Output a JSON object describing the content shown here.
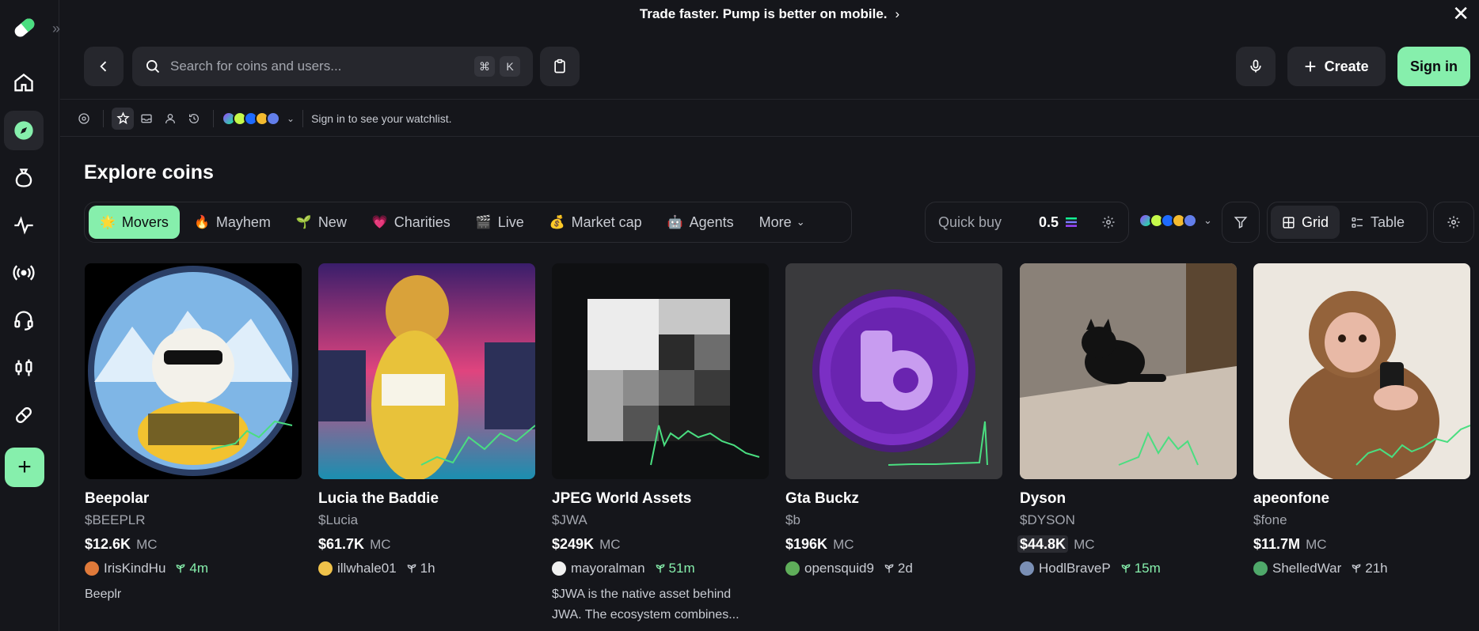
{
  "banner": {
    "text": "Trade faster. Pump is better on mobile."
  },
  "header": {
    "search_placeholder": "Search for coins and users...",
    "shortcut_cmd": "⌘",
    "shortcut_key": "K",
    "create_label": "Create",
    "signin_label": "Sign in"
  },
  "watchbar": {
    "message": "Sign in to see your watchlist."
  },
  "explore": {
    "title": "Explore coins",
    "tabs": [
      {
        "emoji": "🌟",
        "label": "Movers"
      },
      {
        "emoji": "🔥",
        "label": "Mayhem"
      },
      {
        "emoji": "🌱",
        "label": "New"
      },
      {
        "emoji": "💗",
        "label": "Charities"
      },
      {
        "emoji": "🎬",
        "label": "Live"
      },
      {
        "emoji": "💰",
        "label": "Market cap"
      },
      {
        "emoji": "🤖",
        "label": "Agents"
      },
      {
        "emoji": "",
        "label": "More"
      }
    ],
    "quick_buy_label": "Quick buy",
    "quick_buy_value": "0.5",
    "view_grid": "Grid",
    "view_table": "Table"
  },
  "colors": {
    "accent": "#86efac",
    "background": "#15161b",
    "surface": "#26272d"
  },
  "coins": [
    {
      "name": "Beepolar",
      "ticker": "$BEEPLR",
      "mc": "$12.6K",
      "mc_suffix": "MC",
      "creator": "IrisKindHu",
      "age": "4m",
      "age_green": true,
      "description": "Beeplr"
    },
    {
      "name": "Lucia the Baddie",
      "ticker": "$Lucia",
      "mc": "$61.7K",
      "mc_suffix": "MC",
      "creator": "illwhale01",
      "age": "1h",
      "age_green": false,
      "description": ""
    },
    {
      "name": "JPEG World Assets",
      "ticker": "$JWA",
      "mc": "$249K",
      "mc_suffix": "MC",
      "creator": "mayoralman",
      "age": "51m",
      "age_green": true,
      "description": "$JWA is the native asset behind JWA. The ecosystem combines..."
    },
    {
      "name": "Gta Buckz",
      "ticker": "$b",
      "mc": "$196K",
      "mc_suffix": "MC",
      "creator": "opensquid9",
      "age": "2d",
      "age_green": false,
      "description": ""
    },
    {
      "name": "Dyson",
      "ticker": "$DYSON",
      "mc": "$44.8K",
      "mc_suffix": "MC",
      "creator": "HodlBraveP",
      "age": "15m",
      "age_green": true,
      "description": ""
    },
    {
      "name": "apeonfone",
      "ticker": "$fone",
      "mc": "$11.7M",
      "mc_suffix": "MC",
      "creator": "ShelledWar",
      "age": "21h",
      "age_green": false,
      "description": ""
    }
  ]
}
